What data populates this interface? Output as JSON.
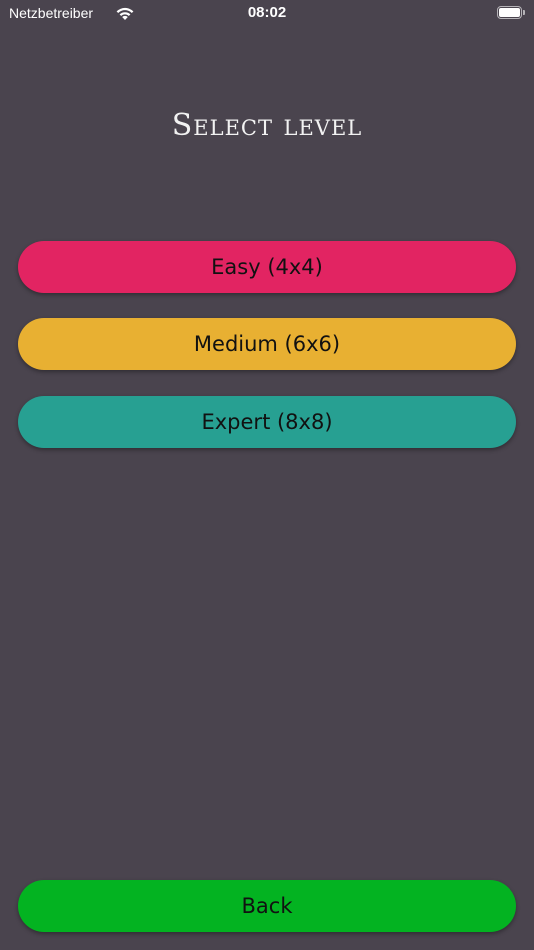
{
  "status_bar": {
    "carrier": "Netzbetreiber",
    "time": "08:02",
    "wifi_icon": "wifi-icon",
    "battery_icon": "battery-icon"
  },
  "screen": {
    "title": "Select level",
    "background_color": "#4a444e"
  },
  "levels": [
    {
      "label": "Easy (4x4)",
      "color": "#e22462"
    },
    {
      "label": "Medium (6x6)",
      "color": "#e8b032"
    },
    {
      "label": "Expert (8x8)",
      "color": "#27a092"
    }
  ],
  "back_button": {
    "label": "Back",
    "color": "#03b321"
  }
}
